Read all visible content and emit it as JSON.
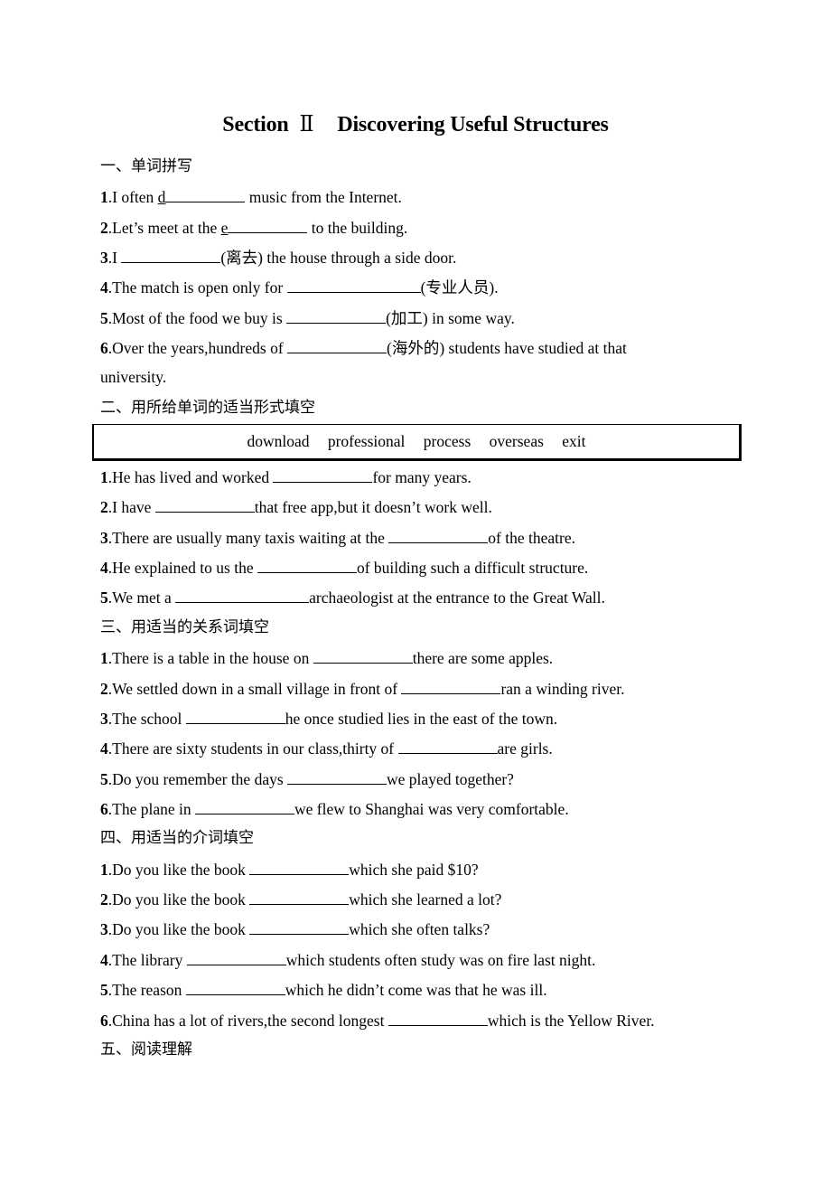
{
  "title": {
    "prefix": "Section",
    "roman": "Ⅱ",
    "main": "Discovering Useful Structures"
  },
  "sections": [
    {
      "heading": "一、单词拼写",
      "items": [
        {
          "num": "1",
          "before": ".I often ",
          "hint_letter": "d",
          "after": " music from the Internet."
        },
        {
          "num": "2",
          "before": ".Let’s meet at the ",
          "hint_letter": "e",
          "after": " to the building."
        },
        {
          "num": "3",
          "before": ".I ",
          "after": "(离去) the house through a side door."
        },
        {
          "num": "4",
          "before": ".The match is open only for ",
          "after": "(专业人员)."
        },
        {
          "num": "5",
          "before": ".Most of the food we buy is ",
          "after": "(加工) in some way."
        },
        {
          "num": "6",
          "before": ".Over the years,hundreds of ",
          "after": "(海外的) students have studied at that",
          "continuation": "university."
        }
      ]
    },
    {
      "heading": "二、用所给单词的适当形式填空",
      "word_bank": [
        "download",
        "professional",
        "process",
        "overseas",
        "exit"
      ],
      "items": [
        {
          "num": "1",
          "before": ".He has lived and worked ",
          "after": "for many years."
        },
        {
          "num": "2",
          "before": ".I have ",
          "after": "that free app,but it doesn’t work well."
        },
        {
          "num": "3",
          "before": ".There are usually many taxis waiting at the ",
          "after": "of the theatre."
        },
        {
          "num": "4",
          "before": ".He explained to us the ",
          "after": "of building such a difficult structure."
        },
        {
          "num": "5",
          "before": ".We met a ",
          "after": "archaeologist at the entrance to the Great Wall."
        }
      ]
    },
    {
      "heading": "三、用适当的关系词填空",
      "items": [
        {
          "num": "1",
          "before": ".There is a table in the house on ",
          "after": "there are some apples."
        },
        {
          "num": "2",
          "before": ".We settled down in a small village in front of ",
          "after": "ran a winding river."
        },
        {
          "num": "3",
          "before": ".The school ",
          "after": "he once studied lies in the east of the town."
        },
        {
          "num": "4",
          "before": ".There are sixty students in our class,thirty of ",
          "after": "are girls."
        },
        {
          "num": "5",
          "before": ".Do you remember the days ",
          "after": "we played together?"
        },
        {
          "num": "6",
          "before": ".The plane in ",
          "after": "we flew to Shanghai was very comfortable."
        }
      ]
    },
    {
      "heading": "四、用适当的介词填空",
      "items": [
        {
          "num": "1",
          "before": ".Do you like the book ",
          "after": "which she paid $10?"
        },
        {
          "num": "2",
          "before": ".Do you like the book ",
          "after": "which she learned a lot?"
        },
        {
          "num": "3",
          "before": ".Do you like the book ",
          "after": "which she often talks?"
        },
        {
          "num": "4",
          "before": ".The library ",
          "after": "which students often study was on fire last night."
        },
        {
          "num": "5",
          "before": ".The reason ",
          "after": "which he didn’t come was that he was ill."
        },
        {
          "num": "6",
          "before": ".China has a lot of rivers,the second longest ",
          "after": "which is the Yellow River."
        }
      ]
    },
    {
      "heading": "五、阅读理解"
    }
  ]
}
